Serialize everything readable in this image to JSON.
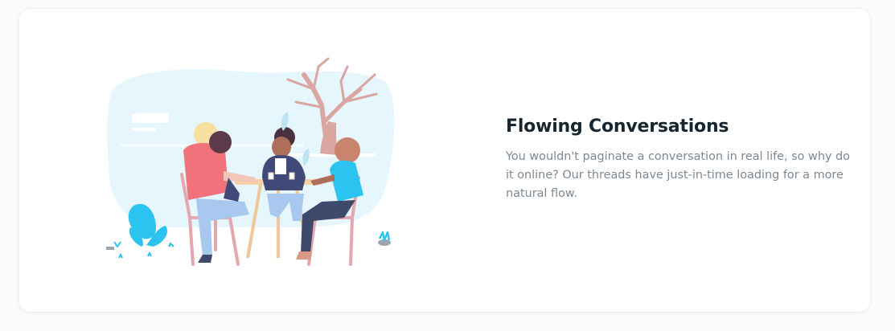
{
  "feature": {
    "title": "Flowing Conversations",
    "description": "You wouldn't paginate a conversation in real life, so why do it online? Our threads have just-in-time loading for a more natural flow."
  },
  "colors": {
    "card_background": "#ffffff",
    "page_background": "#fbfbfc",
    "title": "#17262e",
    "body_text": "#7c8994",
    "sky_blob": "#e6f6fd",
    "accent_cyan": "#2bc3ef",
    "shirt_pink": "#f0727b",
    "tree_trunk": "#d9a6a1"
  },
  "icons": [
    "people-at-table-illustration",
    "tree-icon",
    "plant-icon"
  ]
}
